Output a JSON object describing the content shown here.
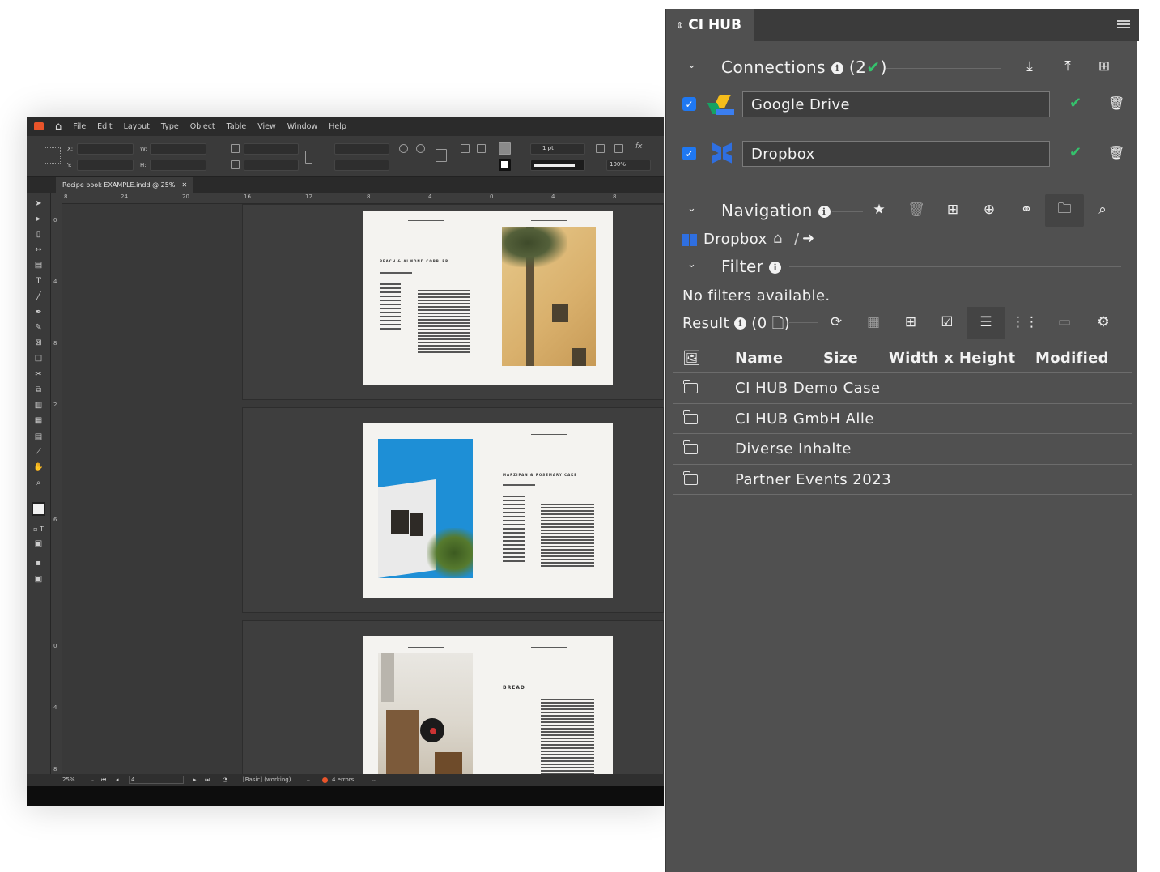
{
  "indesign": {
    "menus": [
      "File",
      "Edit",
      "Layout",
      "Type",
      "Object",
      "Table",
      "View",
      "Window",
      "Help"
    ],
    "doc_tab": "Recipe book EXAMPLE.indd @ 25%",
    "control": {
      "x_label": "X:",
      "y_label": "Y:",
      "w_label": "W:",
      "h_label": "H:",
      "stroke_weight": "1 pt",
      "scale": "100%"
    },
    "ruler_h": [
      "8",
      "24",
      "20",
      "16",
      "12",
      "8",
      "4",
      "0",
      "4",
      "8"
    ],
    "ruler_v": [
      "0",
      "4",
      "8",
      "2",
      "6",
      "0",
      "4",
      "8"
    ],
    "spreads": [
      {
        "heading": "PEACH & ALMOND COBBLER"
      },
      {
        "heading": "MARZIPAN & ROSEMARY CAKE"
      },
      {
        "heading": "BREAD"
      }
    ],
    "status": {
      "zoom": "25%",
      "page": "4",
      "preflight_profile": "[Basic] (working)",
      "errors": "4 errors"
    }
  },
  "cihub": {
    "tab_title": "CI HUB",
    "connections": {
      "title": "Connections",
      "count": "(2",
      "close": ")",
      "services": [
        {
          "name": "Google Drive",
          "checked": true
        },
        {
          "name": "Dropbox",
          "checked": true
        }
      ]
    },
    "navigation": {
      "title": "Navigation",
      "breadcrumb_root": "Dropbox",
      "separator": "/"
    },
    "filter": {
      "title": "Filter",
      "empty_text": "No filters available."
    },
    "result": {
      "title": "Result",
      "count": "(0",
      "close": ")"
    },
    "table": {
      "columns": [
        "Name",
        "Size",
        "Width x Height",
        "Modified"
      ],
      "rows": [
        {
          "name": "CI HUB Demo Case"
        },
        {
          "name": "CI HUB GmbH Alle"
        },
        {
          "name": "Diverse Inhalte"
        },
        {
          "name": "Partner Events 2023"
        }
      ]
    },
    "colors": {
      "panel_bg": "#505050",
      "checkbox": "#1f78f2",
      "status_ok": "#35c26c"
    }
  }
}
